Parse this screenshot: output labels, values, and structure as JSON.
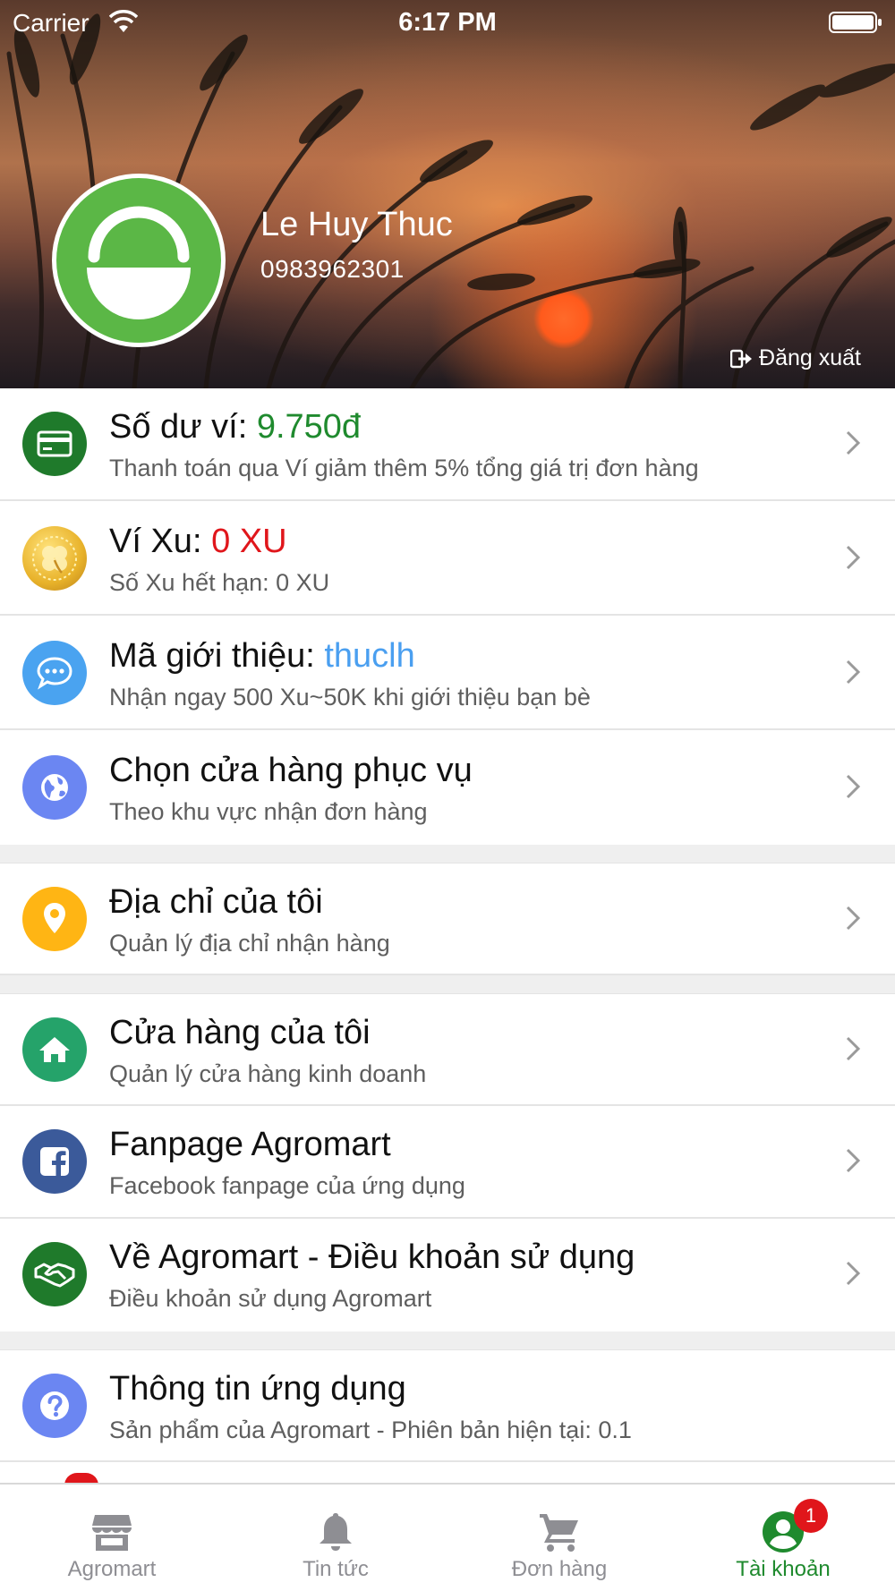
{
  "status_bar": {
    "carrier": "Carrier",
    "time": "6:17 PM"
  },
  "profile": {
    "name": "Le Huy Thuc",
    "phone": "0983962301",
    "logout_label": "Đăng xuất",
    "avatar_color": "#5bb746"
  },
  "menu": [
    {
      "title": "Số dư ví: ",
      "value": "9.750đ",
      "value_color": "#1f8a2e",
      "subtitle": "Thanh toán qua Ví giảm thêm 5% tổng giá trị đơn hàng",
      "icon": "wallet-card-icon",
      "icon_color": "#1f7a2b"
    },
    {
      "title": "Ví Xu: ",
      "value": "0 XU",
      "value_color": "#e0161b",
      "subtitle": "Số Xu hết hạn: 0 XU",
      "icon": "coin-icon",
      "icon_color": "#e8b22a"
    },
    {
      "title": "Mã giới thiệu: ",
      "value": "thuclh",
      "value_color": "#4a9ff0",
      "subtitle": "Nhận ngay 500 Xu~50K khi giới thiệu bạn bè",
      "icon": "chat-bubble-icon",
      "icon_color": "#4aa3f0"
    },
    {
      "title": "Chọn cửa hàng phục vụ",
      "subtitle": "Theo khu vực nhận đơn hàng",
      "icon": "globe-icon",
      "icon_color": "#6b86f2"
    },
    {
      "title": "Địa chỉ của tôi",
      "subtitle": "Quản lý địa chỉ nhận hàng",
      "icon": "location-pin-icon",
      "icon_color": "#ffb514"
    },
    {
      "title": "Cửa hàng của tôi",
      "subtitle": "Quản lý cửa hàng kinh doanh",
      "icon": "home-icon",
      "icon_color": "#25a36a"
    },
    {
      "title": "Fanpage Agromart",
      "subtitle": "Facebook fanpage của ứng dụng",
      "icon": "facebook-icon",
      "icon_color": "#3b5a9a"
    },
    {
      "title": "Về Agromart - Điều khoản sử dụng",
      "subtitle": "Điều khoản sử dụng Agromart",
      "icon": "handshake-icon",
      "icon_color": "#1f7a2b"
    },
    {
      "title": "Thông tin ứng dụng",
      "subtitle": "Sản phẩm của Agromart - Phiên bản hiện tại: 0.1",
      "icon": "help-icon",
      "icon_color": "#6b86f2"
    }
  ],
  "tabs": [
    {
      "label": "Agromart",
      "icon": "store-icon",
      "active": false
    },
    {
      "label": "Tin tức",
      "icon": "bell-icon",
      "active": false
    },
    {
      "label": "Đơn hàng",
      "icon": "cart-icon",
      "active": false
    },
    {
      "label": "Tài khoản",
      "icon": "account-icon",
      "active": true,
      "badge": "1"
    }
  ],
  "colors": {
    "accent": "#1f8a2e",
    "badge": "#e0161b",
    "inactive_tab": "#8e8e93"
  }
}
